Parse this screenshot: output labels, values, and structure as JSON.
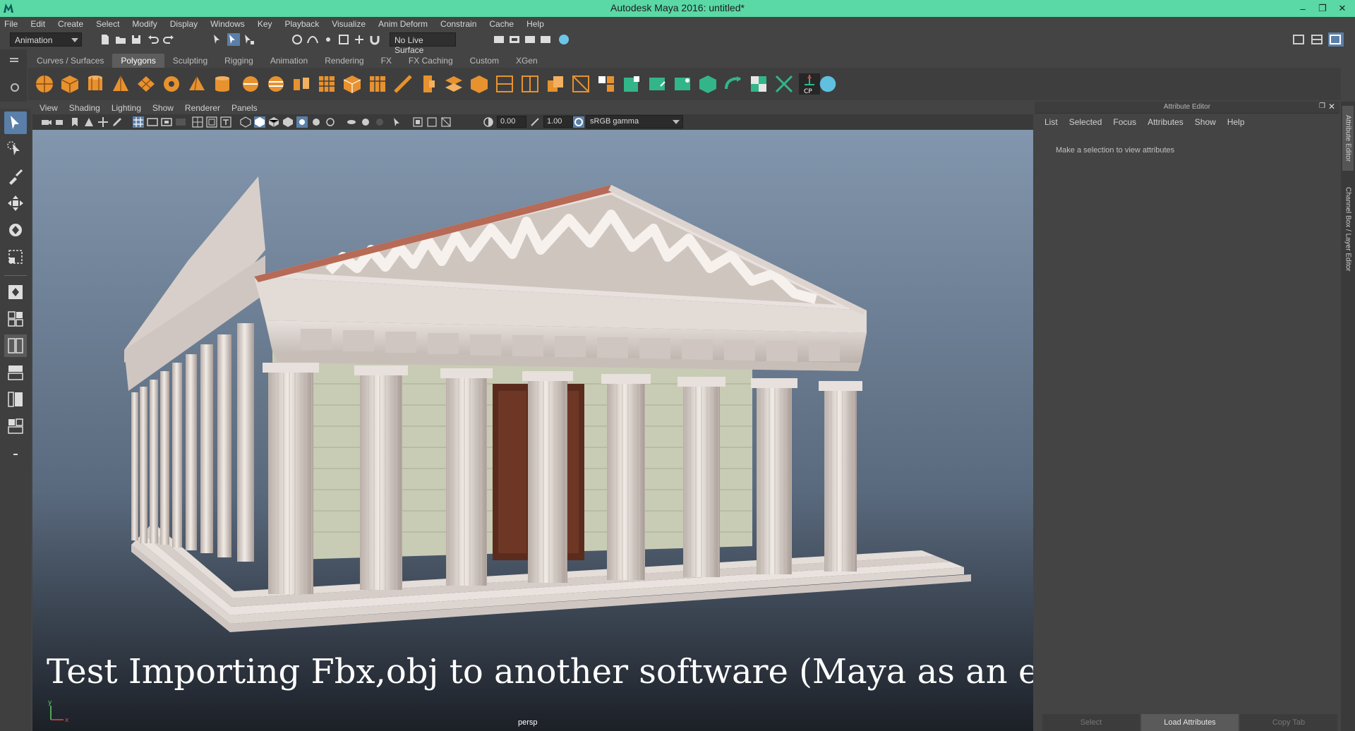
{
  "window": {
    "title": "Autodesk Maya 2016: untitled*"
  },
  "menubar": [
    "File",
    "Edit",
    "Create",
    "Select",
    "Modify",
    "Display",
    "Windows",
    "Key",
    "Playback",
    "Visualize",
    "Anim Deform",
    "Constrain",
    "Cache",
    "Help"
  ],
  "status_line": {
    "menu_set": "Animation",
    "live_surface": "No Live Surface"
  },
  "shelf": {
    "tabs": [
      "Curves / Surfaces",
      "Polygons",
      "Sculpting",
      "Rigging",
      "Animation",
      "Rendering",
      "FX",
      "FX Caching",
      "Custom",
      "XGen"
    ],
    "active_tab": "Polygons",
    "cp_badge": "CP"
  },
  "panel": {
    "menu": [
      "View",
      "Shading",
      "Lighting",
      "Show",
      "Renderer",
      "Panels"
    ],
    "exposure": "0.00",
    "gamma": "1.00",
    "color_space": "sRGB gamma",
    "camera": "persp"
  },
  "caption": "Test Importing Fbx,obj to another software (Maya as an example)",
  "attribute_editor": {
    "title": "Attribute Editor",
    "menu": [
      "List",
      "Selected",
      "Focus",
      "Attributes",
      "Show",
      "Help"
    ],
    "message": "Make a selection to view attributes",
    "buttons": {
      "select": "Select",
      "load": "Load Attributes",
      "copy": "Copy Tab"
    }
  },
  "side_tabs": {
    "attribute_editor": "Attribute Editor",
    "channel_box": "Channel Box / Layer Editor"
  },
  "axis": {
    "x": "x",
    "y": "y"
  },
  "colors": {
    "title_bar": "#5ad8a6",
    "shelf_active": "#5d5d5d",
    "accent": "#5ad8a6"
  }
}
